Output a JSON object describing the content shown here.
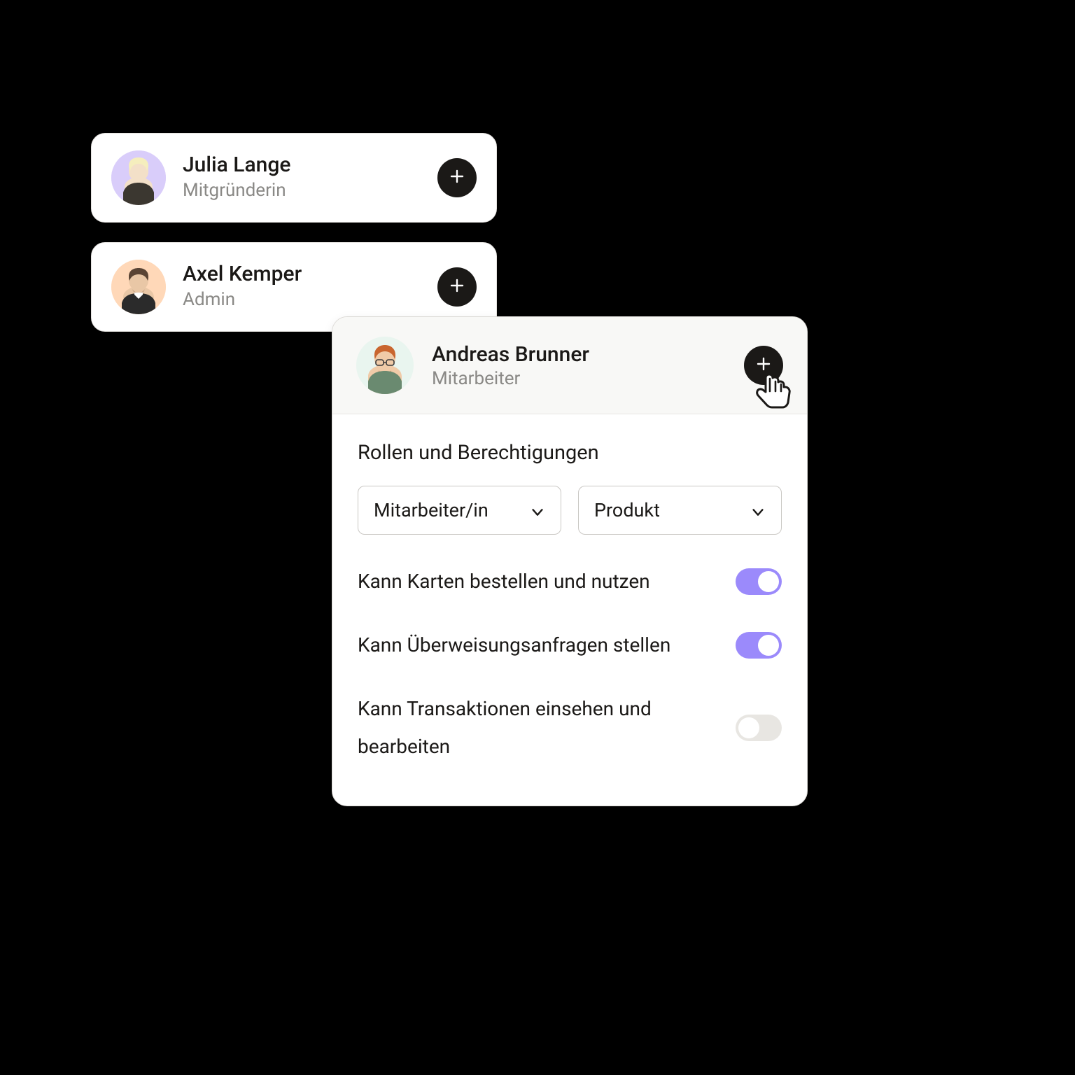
{
  "users": [
    {
      "name": "Julia Lange",
      "role": "Mitgründerin",
      "avatar_bg": "#d9cdfa"
    },
    {
      "name": "Axel Kemper",
      "role": "Admin",
      "avatar_bg": "#ffd8b8"
    }
  ],
  "detail": {
    "name": "Andreas Brunner",
    "role": "Mitarbeiter",
    "avatar_bg": "#e9f5ef",
    "section_title": "Rollen und Berechtigungen",
    "selects": [
      {
        "value": "Mitarbeiter/in"
      },
      {
        "value": "Produkt"
      }
    ],
    "permissions": [
      {
        "label": "Kann Karten bestellen und nutzen",
        "on": true
      },
      {
        "label": "Kann Überweisungsanfragen stellen",
        "on": true
      },
      {
        "label": "Kann Transaktionen einsehen und bearbeiten",
        "on": false
      }
    ]
  },
  "colors": {
    "toggle_on": "#9b8afb",
    "toggle_off": "#e8e6e2"
  }
}
